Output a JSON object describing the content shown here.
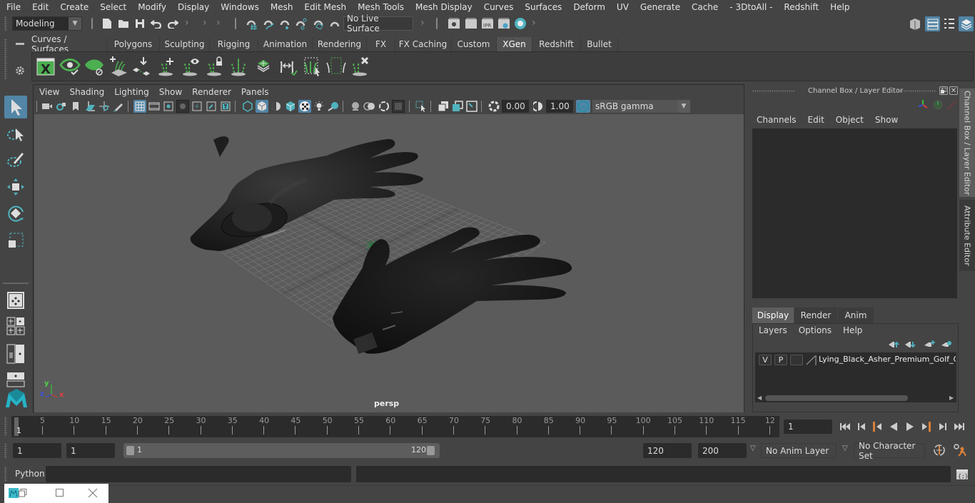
{
  "menubar": {
    "items": [
      "File",
      "Edit",
      "Create",
      "Select",
      "Modify",
      "Display",
      "Windows",
      "Mesh",
      "Edit Mesh",
      "Mesh Tools",
      "Mesh Display",
      "Curves",
      "Surfaces",
      "Deform",
      "UV",
      "Generate",
      "Cache",
      "- 3DtoAll -",
      "Redshift",
      "Help"
    ]
  },
  "toolbar": {
    "mode_select": "Modeling",
    "live_surface": "No Live Surface",
    "icons": [
      "new-scene-icon",
      "open-scene-icon",
      "save-scene-icon",
      "undo-icon",
      "redo-icon",
      "snap-grid-icon",
      "snap-curve-icon",
      "snap-point-icon",
      "snap-projected-center-icon",
      "snap-view-plane-icon",
      "make-live-icon",
      "render-frame-icon",
      "render-sequence-icon",
      "ipr-render-icon",
      "render-settings-icon",
      "hypershade-icon"
    ],
    "right_icons": [
      "modeling-toolkit-icon",
      "channel-box-toggle-icon",
      "attribute-editor-toggle-icon",
      "layer-editor-toggle-icon"
    ]
  },
  "shelf": {
    "tabs": [
      "Curves / Surfaces",
      "Polygons",
      "Sculpting",
      "Rigging",
      "Animation",
      "Rendering",
      "FX",
      "FX Caching",
      "Custom",
      "XGen",
      "Redshift",
      "Bullet"
    ],
    "active_tab": "XGen",
    "icons": [
      "xgen-editor-icon",
      "xgen-preview-icon",
      "xgen-clear-preview-icon",
      "create-description-icon",
      "place-guides-icon",
      "add-guide-icon",
      "show-guides-icon",
      "lock-guides-icon",
      "guide-length-icon",
      "sculpt-guides-icon",
      "guide-transfer-icon",
      "select-guides-icon",
      "guide-region-icon",
      "delete-guides-icon"
    ]
  },
  "left_tools": [
    "select-tool-icon",
    "lasso-tool-icon",
    "paint-select-icon",
    "move-tool-icon",
    "rotate-tool-icon",
    "scale-tool-icon"
  ],
  "layout_icons": [
    "single-perspective-icon",
    "four-view-icon",
    "outliner-persp-icon",
    "graph-persp-icon"
  ],
  "viewport": {
    "menu": [
      "View",
      "Shading",
      "Lighting",
      "Show",
      "Renderer",
      "Panels"
    ],
    "exposure": "0.00",
    "gamma": "1.00",
    "color_mgmt_on": "ON",
    "color_space": "sRGB gamma",
    "camera_label": "persp",
    "axis": {
      "x": "x",
      "y": "y",
      "z": "z"
    }
  },
  "channel_box": {
    "title": "Channel Box / Layer Editor",
    "menu": [
      "Channels",
      "Edit",
      "Object",
      "Show"
    ]
  },
  "layer_editor": {
    "tabs": [
      "Display",
      "Render",
      "Anim"
    ],
    "active_tab": "Display",
    "menu": [
      "Layers",
      "Options",
      "Help"
    ],
    "layers": [
      {
        "visible": "V",
        "playback": "P",
        "name": "Lying_Black_Asher_Premium_Golf_Glov"
      }
    ]
  },
  "side_tabs": [
    "Channel Box / Layer Editor",
    "Attribute Editor"
  ],
  "timeline": {
    "ticks": [
      "5",
      "10",
      "15",
      "20",
      "25",
      "30",
      "35",
      "40",
      "45",
      "50",
      "55",
      "60",
      "65",
      "70",
      "75",
      "80",
      "85",
      "90",
      "95",
      "100",
      "105",
      "110",
      "115",
      "12"
    ],
    "current_marker": "1",
    "current_frame": "1"
  },
  "range": {
    "start": "1",
    "playback_start": "1",
    "slider_start": "1",
    "slider_end": "120",
    "playback_end": "120",
    "end": "200",
    "anim_layer": "No Anim Layer",
    "character_set": "No Character Set"
  },
  "command_line": {
    "language": "Python",
    "input": "",
    "output": ""
  },
  "mini_window": {
    "icons": [
      "maya-app-icon",
      "restore-icon",
      "maximize-icon",
      "close-icon"
    ]
  }
}
